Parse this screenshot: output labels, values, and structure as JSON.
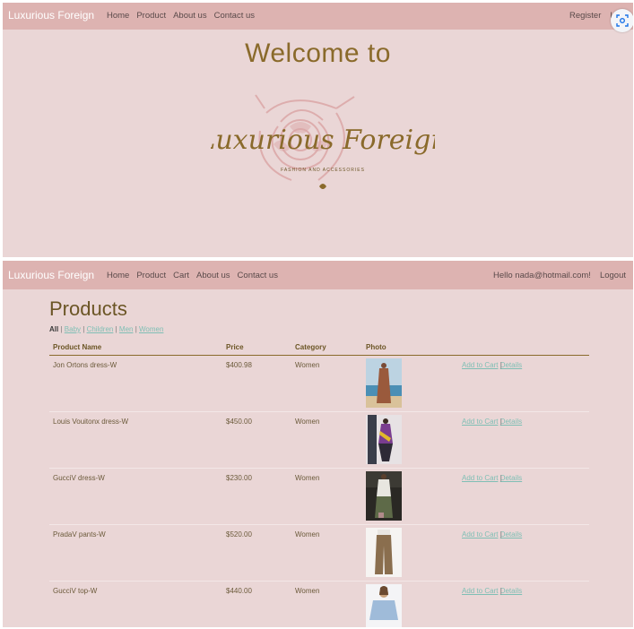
{
  "top": {
    "brand": "Luxurious Foreign",
    "nav": [
      "Home",
      "Product",
      "About us",
      "Contact us"
    ],
    "right": [
      "Register",
      "Lo"
    ],
    "welcome": "Welcome to",
    "logo_script": "Luxurious Foreign",
    "logo_tagline": "FASHION AND ACCESSORIES"
  },
  "bottom": {
    "brand": "Luxurious Foreign",
    "nav": [
      "Home",
      "Product",
      "Cart",
      "About us",
      "Contact us"
    ],
    "greeting": "Hello nada@hotmail.com!",
    "logout": "Logout",
    "title": "Products",
    "filters": {
      "all": "All",
      "sep": "|",
      "items": [
        "Baby",
        "Children",
        "Men",
        "Women"
      ]
    },
    "columns": {
      "name": "Product Name",
      "price": "Price",
      "category": "Category",
      "photo": "Photo"
    },
    "actions": {
      "add": "Add to Cart",
      "sep": "|",
      "details": "Details"
    },
    "rows": [
      {
        "name": "Jon Ortons dress-W",
        "price": "$400.98",
        "category": "Women"
      },
      {
        "name": "Louis Vouitonx dress-W",
        "price": "$450.00",
        "category": "Women"
      },
      {
        "name": "GucciV dress-W",
        "price": "$230.00",
        "category": "Women"
      },
      {
        "name": "PradaV pants-W",
        "price": "$520.00",
        "category": "Women"
      },
      {
        "name": "GucciV top-W",
        "price": "$440.00",
        "category": "Women"
      }
    ]
  }
}
